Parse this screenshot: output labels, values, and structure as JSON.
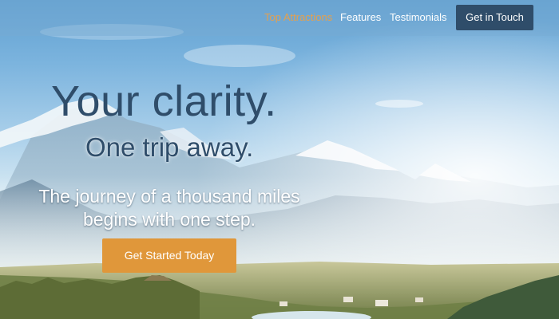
{
  "nav": {
    "links": [
      {
        "label": "Top Attractions",
        "active": true
      },
      {
        "label": "Features",
        "active": false
      },
      {
        "label": "Testimonials",
        "active": false
      }
    ],
    "cta_label": "Get in Touch"
  },
  "hero": {
    "headline": "Your clarity.",
    "subheadline": "One trip away.",
    "tagline_line1": "The journey of a thousand miles",
    "tagline_line2": "begins with one step.",
    "cta_label": "Get Started Today"
  },
  "colors": {
    "nav_active": "#e3a050",
    "nav_cta_bg": "#2f4d6a",
    "hero_cta_bg": "#e0973a",
    "headline": "#2f4d6a"
  }
}
